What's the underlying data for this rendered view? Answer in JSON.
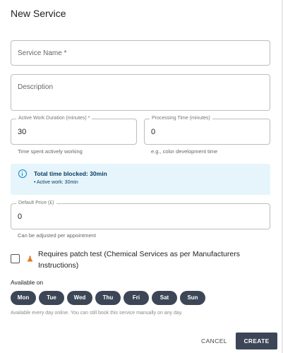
{
  "dialog": {
    "title": "New Service"
  },
  "fields": {
    "service_name": {
      "placeholder": "Service Name *",
      "value": ""
    },
    "description": {
      "placeholder": "Description",
      "value": ""
    },
    "active_duration": {
      "label": "Active Work Duration (minutes) *",
      "value": "30",
      "helper": "Time spent actively working"
    },
    "processing_time": {
      "label": "Processing Time (minutes)",
      "value": "0",
      "helper": "e.g., color development time"
    },
    "default_price": {
      "label": "Default Price (£)",
      "value": "0",
      "helper": "Can be adjusted per appointment"
    }
  },
  "info_alert": {
    "headline": "Total time blocked: 30min",
    "detail": "• Active work: 30min",
    "icon": "info-icon",
    "color": "#0b84c6",
    "background": "#e5f5fb"
  },
  "patch_test": {
    "checked": false,
    "icon": "flask-icon",
    "icon_color": "#e07b24",
    "label": "Requires patch test (Chemical Services as per Manufacturers Instructions)"
  },
  "availability": {
    "label": "Available on",
    "days": [
      "Mon",
      "Tue",
      "Wed",
      "Thu",
      "Fri",
      "Sat",
      "Sun"
    ],
    "helper": "Available every day online. You can still book this service manually on any day.",
    "chip_color": "#3c4656"
  },
  "actions": {
    "cancel": "CANCEL",
    "create": "CREATE"
  }
}
